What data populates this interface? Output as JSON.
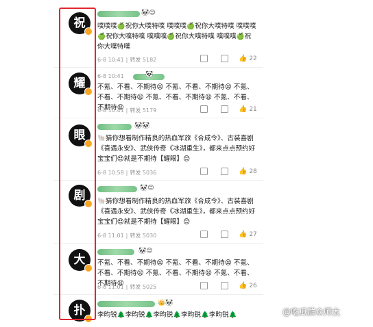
{
  "posts": [
    {
      "avatar_char": "祝",
      "name_emoji": "🐼😊",
      "text": "噗噗噗🍏祝你大噗特噗 噗噗噗🍏祝你大噗特噗 噗噗噗🍏祝你大噗特噗 噗噗噗🍏祝你大噗特噗 噗噗噗🍏祝你大噗特噗",
      "date": "6-8 10:41",
      "repost": "转发 5182",
      "comments": "",
      "likes": "22"
    },
    {
      "avatar_char": "耀",
      "name_emoji": "🐼",
      "text": "不氪、不看、不期待😫 不氪、不看、不期待😫 不氪、不看、不期待😫 不氪、不看、不期待😫 不氪、不看、不期待😫",
      "date": "6-8 10:41",
      "repost": "转发 5179",
      "comments": "",
      "likes": "21"
    },
    {
      "avatar_char": "眼",
      "name_emoji": "🐼🐼",
      "text": "🐚猜你想看制作精良的热血军旅《合成令》、古装喜剧《喜遇永安》、武侠传奇《冰湖重生》，都来点点预约好宝宝们😍就是不期待【耀眼】😊",
      "date": "6-8 10:58",
      "repost": "转发 5036",
      "comments": "",
      "likes": "28"
    },
    {
      "avatar_char": "剧",
      "name_emoji": "🐼😊",
      "text": "🐚猜你想看制作精良的热血军旅《合成令》、古装喜剧《喜遇永安》、武侠传奇《冰湖重生》，都来点点预约好宝宝们😍就是不期待【耀眼】😊",
      "date": "6-8 11:01",
      "repost": "转发 5030",
      "comments": "",
      "likes": "27"
    },
    {
      "avatar_char": "大",
      "name_emoji": "🐼😊",
      "text": "不氪、不看、不期待😫 不氪、不看、不期待😫 不氪、不看、不期待😫 不氪、不看、不期待😫 不氪、不看、不期待😫",
      "date": "6-8 11:01",
      "repost": "转发 5025",
      "comments": "",
      "likes": "26"
    },
    {
      "avatar_char": "扑",
      "name_emoji": "👑🐼",
      "text": "李昀锐🌲李昀锐🌲李昀锐🌲李昀锐🌲李昀锐🌲",
      "date": "",
      "repost": "",
      "comments": "",
      "likes": ""
    }
  ],
  "watermark": "@吃瓜群众师太",
  "colors": {
    "highlight_box": "#e0262f",
    "verified_badge": "#f5a623"
  }
}
